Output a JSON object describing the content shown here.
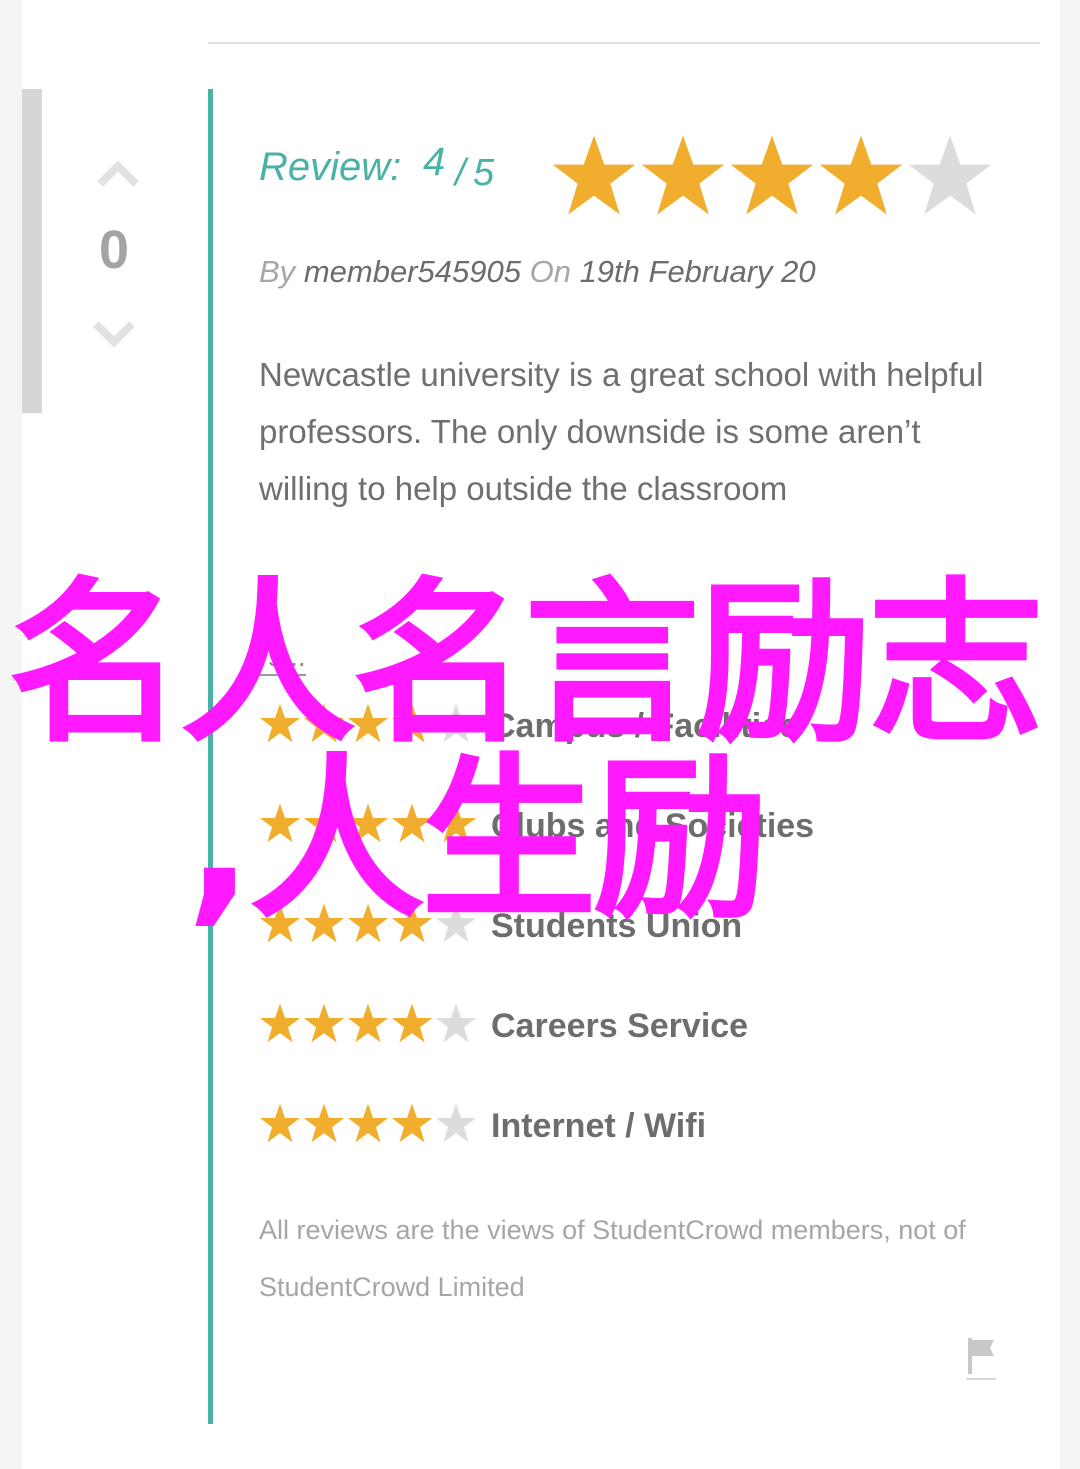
{
  "vote": {
    "count": "0",
    "up_icon": "chevron-up-icon",
    "down_icon": "chevron-down-icon"
  },
  "review": {
    "label": "Review:",
    "score": "4",
    "slash": "/",
    "max": "5",
    "rating_value": 4,
    "rating_max": 5,
    "by_prefix": "By",
    "author": "member545905",
    "on_prefix": "On",
    "date": "19th February 20",
    "body": "Newcastle university is a great school with helpful professors. The only downside is some aren’t willing to help outside the classroom",
    "more_link": "rs..."
  },
  "categories": [
    {
      "label": "Campus / Facilities",
      "rating": 4
    },
    {
      "label": "Clubs and Societies",
      "rating": 5
    },
    {
      "label": "Students Union",
      "rating": 4
    },
    {
      "label": "Careers Service",
      "rating": 4
    },
    {
      "label": "Internet / Wifi",
      "rating": 4
    }
  ],
  "disclaimer": "All reviews are the views of StudentCrowd members, not of StudentCrowd Limited",
  "flag_icon": "flag-icon",
  "overlay": {
    "line1": "名人名言励志",
    "line2": ",人生励"
  },
  "colors": {
    "accent": "#4ab2a5",
    "star_filled": "#f1ad2d",
    "star_empty": "#dcdcdc",
    "overlay": "#ff19ff"
  }
}
